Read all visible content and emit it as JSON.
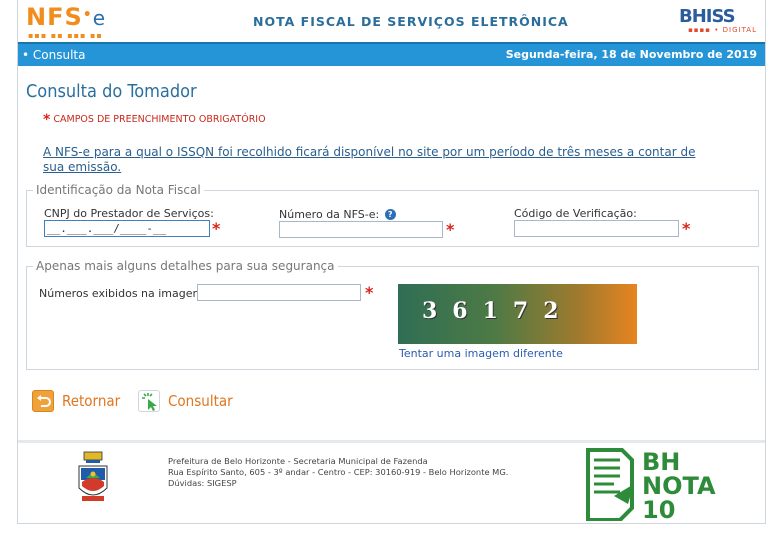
{
  "header": {
    "logo_text": "NFS",
    "logo_e": "e",
    "title": "NOTA FISCAL DE SERVIÇOS ELETRÔNICA",
    "brand": "BHISS",
    "brand_sub": "DIGITAL"
  },
  "nav": {
    "breadcrumb": "• Consulta",
    "date": "Segunda-feira, 18 de Novembro de 2019"
  },
  "page": {
    "title": "Consulta do Tomador",
    "required_note": "CAMPOS DE PREENCHIMENTO OBRIGATÓRIO",
    "info_link": "A NFS-e para a qual o ISSQN foi recolhido ficará disponível no site por um período de três meses a contar de sua emissão."
  },
  "invoice_section": {
    "legend": "Identificação da Nota Fiscal",
    "cnpj_label": "CNPJ do Prestador de Serviços:",
    "cnpj_value": "__.___.___/____-__",
    "nfse_label": "Número da NFS-e:",
    "nfse_value": "",
    "code_label": "Código de Verificação:",
    "code_value": ""
  },
  "security_section": {
    "legend": "Apenas mais alguns detalhes para sua segurança",
    "captcha_label": "Números exibidos na imagem:",
    "captcha_value": "",
    "captcha_digits": "36172",
    "captcha_refresh": "Tentar uma imagem diferente"
  },
  "buttons": {
    "back": "Retornar",
    "search": "Consultar"
  },
  "footer": {
    "line1": "Prefeitura de Belo Horizonte - Secretaria Municipal de Fazenda",
    "line2": "Rua Espírito Santo, 605 - 3º andar - Centro - CEP: 30160-919 - Belo Horizonte MG.",
    "line3": "Dúvidas: SIGESP",
    "badge_line1": "BH",
    "badge_line2": "NOTA",
    "badge_line3": "10"
  },
  "colors": {
    "accent_blue": "#2595d8",
    "required_red": "#d8261c",
    "button_orange": "#e07620",
    "badge_green": "#2e8b3a"
  }
}
